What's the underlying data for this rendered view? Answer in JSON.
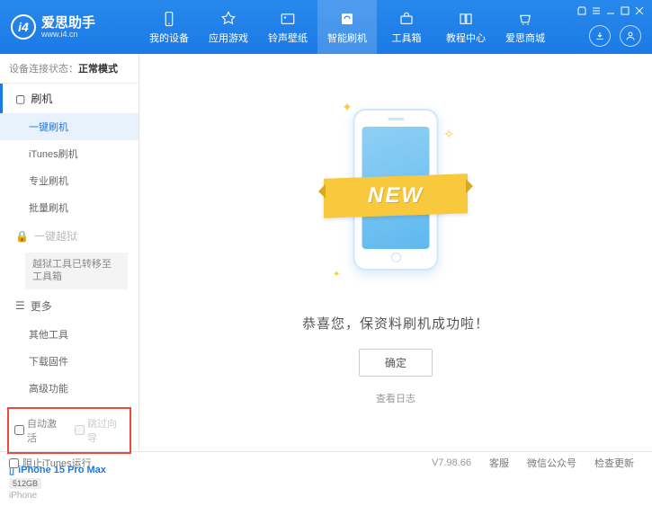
{
  "header": {
    "logo_title": "爱思助手",
    "logo_sub": "www.i4.cn",
    "nav": [
      {
        "label": "我的设备"
      },
      {
        "label": "应用游戏"
      },
      {
        "label": "铃声壁纸"
      },
      {
        "label": "智能刷机"
      },
      {
        "label": "工具箱"
      },
      {
        "label": "教程中心"
      },
      {
        "label": "爱思商城"
      }
    ]
  },
  "sidebar": {
    "status_label": "设备连接状态：",
    "status_value": "正常模式",
    "section_flash": "刷机",
    "items_flash": [
      "一键刷机",
      "iTunes刷机",
      "专业刷机",
      "批量刷机"
    ],
    "section_jailbreak": "一键越狱",
    "jailbreak_note": "越狱工具已转移至工具箱",
    "section_more": "更多",
    "items_more": [
      "其他工具",
      "下载固件",
      "高级功能"
    ],
    "checkbox_auto": "自动激活",
    "checkbox_skip": "跳过向导",
    "device_name": "iPhone 15 Pro Max",
    "device_storage": "512GB",
    "device_type": "iPhone"
  },
  "main": {
    "ribbon": "NEW",
    "success": "恭喜您，保资料刷机成功啦！",
    "ok": "确定",
    "view_log": "查看日志"
  },
  "footer": {
    "block_itunes": "阻止iTunes运行",
    "version": "V7.98.66",
    "items": [
      "客服",
      "微信公众号",
      "检查更新"
    ]
  }
}
